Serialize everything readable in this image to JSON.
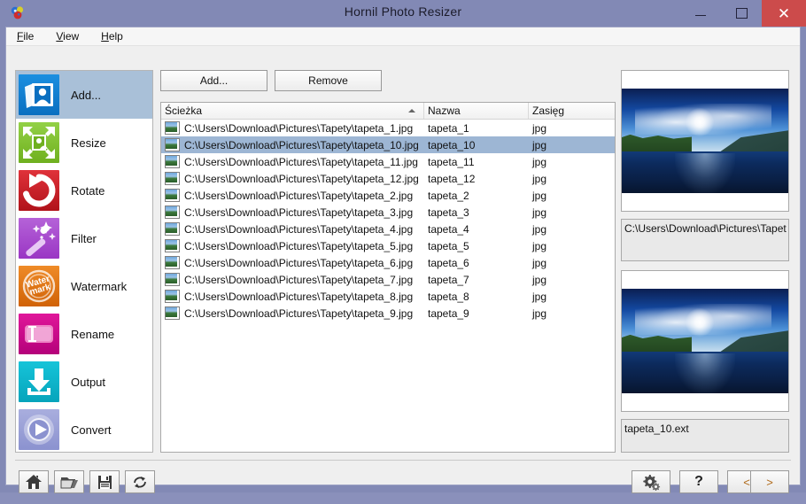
{
  "window": {
    "title": "Hornil Photo Resizer",
    "app_icon": "app-logo-icon",
    "minimize_label": "Minimize",
    "maximize_label": "Maximize",
    "close_label": "Close",
    "titlebar_color": "#8289b5",
    "close_button_color": "#cc4b4b"
  },
  "menubar": {
    "items": [
      {
        "label": "File",
        "accel": "F"
      },
      {
        "label": "View",
        "accel": "V"
      },
      {
        "label": "Help",
        "accel": "H"
      }
    ]
  },
  "sidebar": {
    "selected_index": 0,
    "items": [
      {
        "label": "Add...",
        "icon": "add-photo-icon",
        "color": "#0a78cc"
      },
      {
        "label": "Resize",
        "icon": "resize-icon",
        "color": "#7ec02a"
      },
      {
        "label": "Rotate",
        "icon": "rotate-icon",
        "color": "#cc1f28"
      },
      {
        "label": "Filter",
        "icon": "magic-wand-icon",
        "color": "#a44bcf"
      },
      {
        "label": "Watermark",
        "icon": "watermark-icon",
        "color": "#e0750f"
      },
      {
        "label": "Rename",
        "icon": "rename-icon",
        "color": "#c70a87"
      },
      {
        "label": "Output",
        "icon": "download-icon",
        "color": "#0fb4ca"
      },
      {
        "label": "Convert",
        "icon": "play-icon",
        "color": "#959ad6"
      }
    ]
  },
  "list_panel": {
    "add_button": "Add...",
    "remove_button": "Remove",
    "columns": [
      "Ścieżka",
      "Nazwa",
      "Zasięg"
    ],
    "sort_column": "Ścieżka",
    "sort_direction": "ascending",
    "selected_row": 1,
    "rows": [
      {
        "path": "C:\\Users\\Download\\Pictures\\Tapety\\tapeta_1.jpg",
        "name": "tapeta_1",
        "ext": "jpg"
      },
      {
        "path": "C:\\Users\\Download\\Pictures\\Tapety\\tapeta_10.jpg",
        "name": "tapeta_10",
        "ext": "jpg"
      },
      {
        "path": "C:\\Users\\Download\\Pictures\\Tapety\\tapeta_11.jpg",
        "name": "tapeta_11",
        "ext": "jpg"
      },
      {
        "path": "C:\\Users\\Download\\Pictures\\Tapety\\tapeta_12.jpg",
        "name": "tapeta_12",
        "ext": "jpg"
      },
      {
        "path": "C:\\Users\\Download\\Pictures\\Tapety\\tapeta_2.jpg",
        "name": "tapeta_2",
        "ext": "jpg"
      },
      {
        "path": "C:\\Users\\Download\\Pictures\\Tapety\\tapeta_3.jpg",
        "name": "tapeta_3",
        "ext": "jpg"
      },
      {
        "path": "C:\\Users\\Download\\Pictures\\Tapety\\tapeta_4.jpg",
        "name": "tapeta_4",
        "ext": "jpg"
      },
      {
        "path": "C:\\Users\\Download\\Pictures\\Tapety\\tapeta_5.jpg",
        "name": "tapeta_5",
        "ext": "jpg"
      },
      {
        "path": "C:\\Users\\Download\\Pictures\\Tapety\\tapeta_6.jpg",
        "name": "tapeta_6",
        "ext": "jpg"
      },
      {
        "path": "C:\\Users\\Download\\Pictures\\Tapety\\tapeta_7.jpg",
        "name": "tapeta_7",
        "ext": "jpg"
      },
      {
        "path": "C:\\Users\\Download\\Pictures\\Tapety\\tapeta_8.jpg",
        "name": "tapeta_8",
        "ext": "jpg"
      },
      {
        "path": "C:\\Users\\Download\\Pictures\\Tapety\\tapeta_9.jpg",
        "name": "tapeta_9",
        "ext": "jpg"
      }
    ],
    "selected_row_color": "#9db6d4"
  },
  "preview": {
    "source": {
      "caption": "C:\\Users\\Download\\Pictures\\Tapet",
      "image_alt": "lake-landscape-preview"
    },
    "target": {
      "caption": "tapeta_10.ext",
      "image_alt": "lake-landscape-preview"
    }
  },
  "bottom_toolbar": {
    "left_buttons": [
      {
        "icon": "home-icon",
        "label": "Home"
      },
      {
        "icon": "folder-icon",
        "label": "Open"
      },
      {
        "icon": "save-icon",
        "label": "Save"
      },
      {
        "icon": "refresh-icon",
        "label": "Refresh"
      }
    ],
    "right_buttons": [
      {
        "icon": "gears-icon",
        "label": ""
      },
      {
        "icon": "question-icon",
        "label": "?"
      },
      {
        "icon": "prev-icon",
        "label": "<"
      },
      {
        "icon": "next-icon",
        "label": ">"
      }
    ]
  }
}
